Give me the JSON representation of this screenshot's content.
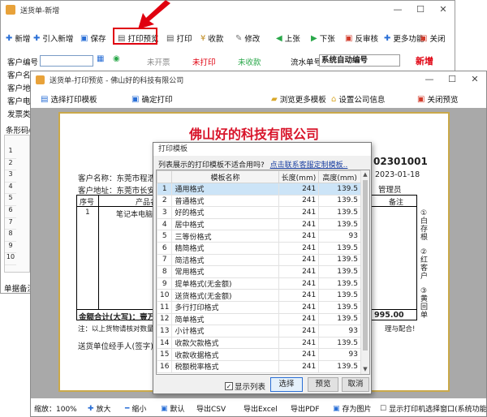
{
  "main_window": {
    "title": "送货单-新增",
    "controls": [
      "—",
      "☐",
      "✕"
    ],
    "toolbar": [
      {
        "label": "新增",
        "icon": "plus-icon",
        "color": "#2a6fd6"
      },
      {
        "label": "引入新增",
        "icon": "import-icon",
        "color": "#2a6fd6"
      },
      {
        "label": "保存",
        "icon": "save-icon",
        "color": "#2a6fd6"
      },
      {
        "label": "打印预览",
        "icon": "print-preview-icon",
        "color": "#555555"
      },
      {
        "label": "打印",
        "icon": "printer-icon",
        "color": "#555555"
      },
      {
        "label": "收款",
        "icon": "money-icon",
        "color": "#c08a1e"
      },
      {
        "label": "修改",
        "icon": "edit-icon",
        "color": "#777777"
      },
      {
        "label": "上张",
        "icon": "prev-icon",
        "color": "#2aa84a"
      },
      {
        "label": "下张",
        "icon": "next-icon",
        "color": "#2aa84a"
      },
      {
        "label": "反审核",
        "icon": "unreview-icon",
        "color": "#d23b2b"
      },
      {
        "label": "更多功能",
        "icon": "more-icon",
        "color": "#2a6fd6"
      },
      {
        "label": "关闭",
        "icon": "close-icon",
        "color": "#d23b2b"
      }
    ],
    "form": {
      "customer_no_label": "客户编号",
      "status_not_invoiced": "未开票",
      "status_not_printed": "未打印",
      "status_not_collected": "未收款",
      "serial_label": "流水单号",
      "serial_value": "系统自动编号",
      "mode_tag": "新增",
      "row_labels": [
        "客户名称",
        "客户地址",
        "客户电话",
        "发票类型"
      ],
      "barcode_label": "条形码(F",
      "row_numbers": [
        "1",
        "2",
        "3",
        "4",
        "5",
        "6",
        "7",
        "8",
        "9",
        "10"
      ],
      "remark_label": "单据备注"
    }
  },
  "preview_window": {
    "title": "送货单-打印预览 - 佛山好的科技有限公司",
    "controls": [
      "—",
      "☐",
      "✕"
    ],
    "toolbar_left": [
      {
        "label": "选择打印模板",
        "icon": "template-icon"
      },
      {
        "label": "确定打印",
        "icon": "confirm-print-icon"
      }
    ],
    "toolbar_right": [
      {
        "label": "浏览更多模板",
        "icon": "folder-icon"
      },
      {
        "label": "设置公司信息",
        "icon": "home-icon"
      },
      {
        "label": "关闭预览",
        "icon": "close-icon"
      }
    ],
    "doc": {
      "company": "佛山好的科技有限公司",
      "order_no_tail": "02301001",
      "date": "2023-01-18",
      "customer_name_label": "客户名称：东莞市程浩光",
      "customer_addr_label": "客户地址：东莞市长安镇",
      "manager_label": "管理员",
      "col_seq": "序号",
      "col_product": "产品名称",
      "col_remark": "备注",
      "row1_seq": "1",
      "row1_product": "笔记本电脑",
      "total_label": "金额合计(大写)：壹万玖",
      "total_value": "995.00",
      "note_text": "注：以上货物请核对数量，",
      "note_tail": "理与配合!",
      "signer_label": "送货单位经手人(签字)：",
      "side_notes": [
        "①白存根",
        "②红客户",
        "③黄回单"
      ]
    },
    "bottom_toolbar": [
      {
        "label": "缩放：100%",
        "icon": ""
      },
      {
        "label": "放大",
        "icon": "zoom-in-icon"
      },
      {
        "label": "缩小",
        "icon": "zoom-out-icon"
      },
      {
        "label": "默认",
        "icon": "default-icon"
      },
      {
        "label": "导出CSV",
        "icon": ""
      },
      {
        "label": "导出Excel",
        "icon": ""
      },
      {
        "label": "导出PDF",
        "icon": ""
      },
      {
        "label": "存为图片",
        "icon": "image-icon"
      },
      {
        "label": "显示打印机选择窗口(系统功能参数)",
        "icon": "checkbox-icon"
      }
    ]
  },
  "template_dialog": {
    "title": "打印模板",
    "question": "列表展示的打印模板不适合用吗?",
    "link": "点击联系客服定制模板..",
    "headers": [
      "",
      "模板名称",
      "长度(mm)",
      "高度(mm)"
    ],
    "rows": [
      {
        "no": "1",
        "name": "通用格式",
        "len": "241",
        "h": "139.5"
      },
      {
        "no": "2",
        "name": "普通格式",
        "len": "241",
        "h": "139.5"
      },
      {
        "no": "3",
        "name": "好的格式",
        "len": "241",
        "h": "139.5"
      },
      {
        "no": "4",
        "name": "居中格式",
        "len": "241",
        "h": "139.5"
      },
      {
        "no": "5",
        "name": "三等份格式",
        "len": "241",
        "h": "93"
      },
      {
        "no": "6",
        "name": "精简格式",
        "len": "241",
        "h": "139.5"
      },
      {
        "no": "7",
        "name": "简洁格式",
        "len": "241",
        "h": "139.5"
      },
      {
        "no": "8",
        "name": "常用格式",
        "len": "241",
        "h": "139.5"
      },
      {
        "no": "9",
        "name": "提单格式(无金额)",
        "len": "241",
        "h": "139.5"
      },
      {
        "no": "10",
        "name": "送货格式(无金额)",
        "len": "241",
        "h": "139.5"
      },
      {
        "no": "11",
        "name": "多行打印格式",
        "len": "241",
        "h": "139.5"
      },
      {
        "no": "12",
        "name": "简单格式",
        "len": "241",
        "h": "139.5"
      },
      {
        "no": "13",
        "name": "小计格式",
        "len": "241",
        "h": "93"
      },
      {
        "no": "14",
        "name": "收款欠款格式",
        "len": "241",
        "h": "139.5"
      },
      {
        "no": "15",
        "name": "收款收据格式",
        "len": "241",
        "h": "93"
      },
      {
        "no": "16",
        "name": "税额税率格式",
        "len": "241",
        "h": "139.5"
      }
    ],
    "show_list_label": "显示列表",
    "show_list_checked": true,
    "select_label": "选择",
    "preview_label": "预览",
    "cancel_label": "取消"
  },
  "colors": {
    "accent_red": "#e0000f",
    "company_red": "#d8142a",
    "doc_border": "#caa94a",
    "selection_blue": "#cce4f7",
    "link_blue": "#1a3fa0"
  }
}
